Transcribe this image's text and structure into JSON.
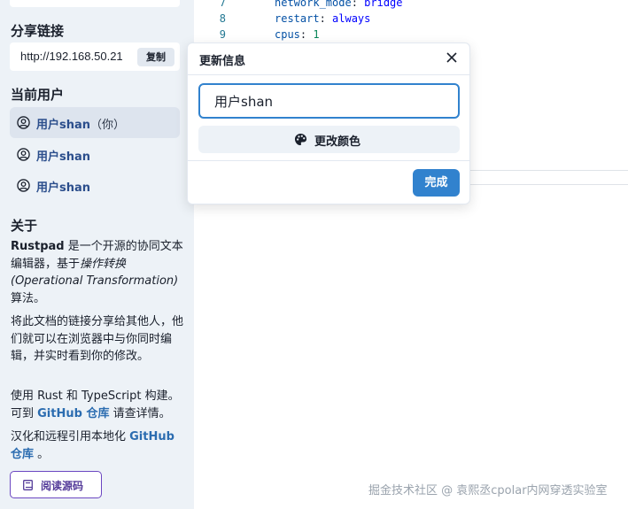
{
  "sidebar": {
    "share_heading": "分享链接",
    "share_url": "http://192.168.50.21",
    "copy_label": "复制",
    "users_heading": "当前用户",
    "users": [
      {
        "name": "用户shan",
        "suffix": "（你）"
      },
      {
        "name": "用户shan",
        "suffix": ""
      },
      {
        "name": "用户shan",
        "suffix": ""
      }
    ],
    "about_heading": "关于",
    "about": {
      "p1_bold": "Rustpad",
      "p1_a": " 是一个开源的协同文本编辑器，基于",
      "p1_italic_a": "操作转换",
      "p1_italic_b": "(Operational Transformation)",
      "p1_b": "算法。",
      "p2": "将此文档的链接分享给其他人，他们就可以在浏览器中与你同时编辑，并实时看到你的修改。",
      "p3_a": "使用 Rust 和 TypeScript 构建。可到 ",
      "p3_link": "GitHub 仓库",
      "p3_b": " 请查详情。",
      "p4_a": "汉化和远程引用本地化 ",
      "p4_link": "GitHub 仓库",
      "p4_b": " 。"
    },
    "read_source_label": "阅读源码"
  },
  "editor": {
    "lines": [
      {
        "num": "7",
        "key": "network_mode",
        "value": "bridge",
        "type": "string"
      },
      {
        "num": "8",
        "key": "restart",
        "value": "always",
        "type": "string"
      },
      {
        "num": "9",
        "key": "cpus",
        "value": "1",
        "type": "number"
      }
    ]
  },
  "modal": {
    "title": "更新信息",
    "name_value": "用户shan",
    "change_color_label": "更改颜色",
    "done_label": "完成"
  },
  "watermark": "掘金技术社区 @ 袁熙丞cpolar内网穿透实验室",
  "colors": {
    "accent": "#3182ce",
    "sidebar_bg": "#edf2f7",
    "user_name": "#2b4e8c",
    "link": "#2b6cb0",
    "read_btn_border": "#6b46c1"
  }
}
